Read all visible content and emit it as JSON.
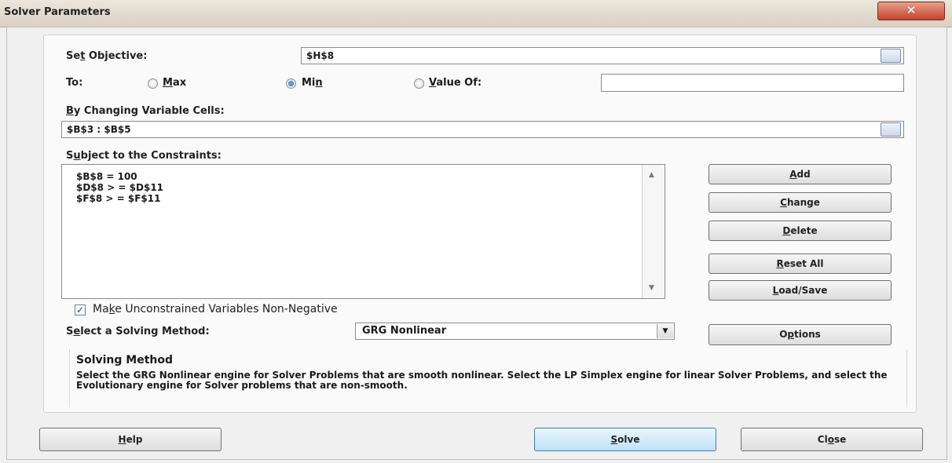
{
  "window": {
    "title": "Solver Parameters",
    "close_glyph": "✕"
  },
  "objective": {
    "label_pre": "Se",
    "label_key": "t",
    "label_post": " Objective:",
    "value": "$H$8"
  },
  "to": {
    "label": "To:",
    "max": {
      "key": "M",
      "rest": "ax",
      "selected": false
    },
    "min": {
      "pre": "Mi",
      "key": "n",
      "selected": true
    },
    "value_of": {
      "key": "V",
      "rest": "alue Of:",
      "value": "",
      "selected": false
    }
  },
  "changing": {
    "label_key": "B",
    "label_rest": "y Changing Variable Cells:",
    "value": "$B$3 : $B$5"
  },
  "constraints": {
    "label_pre": "S",
    "label_key": "u",
    "label_post": "bject to the Constraints:",
    "items": [
      "$B$8 = 100",
      "$D$8 > = $D$11",
      "$F$8 > = $F$11"
    ]
  },
  "buttons": {
    "add": {
      "key": "A",
      "rest": "dd"
    },
    "change": {
      "key": "C",
      "rest": "hange"
    },
    "delete": {
      "key": "D",
      "rest": "elete"
    },
    "reset_all": {
      "key": "R",
      "rest": "eset All"
    },
    "load_save": {
      "key": "L",
      "rest": "oad/Save"
    },
    "options": {
      "pre": "O",
      "key": "p",
      "rest": "tions"
    },
    "help": {
      "key": "H",
      "rest": "elp"
    },
    "solve": {
      "key": "S",
      "rest": "olve"
    },
    "close": {
      "pre": "Cl",
      "key": "o",
      "rest": "se"
    }
  },
  "nonneg": {
    "checked": true,
    "check_glyph": "✓",
    "label_pre": "Ma",
    "label_key": "k",
    "label_post": "e Unconstrained Variables Non-Negative"
  },
  "method": {
    "label_pre": "S",
    "label_key": "e",
    "label_post": "lect a Solving Method:",
    "value": "GRG Nonlinear",
    "arrow_glyph": "▼"
  },
  "solving_method": {
    "title": "Solving Method",
    "description": "Select the GRG Nonlinear engine for Solver Problems that are smooth nonlinear. Select the LP Simplex engine for linear Solver Problems, and select the Evolutionary engine for Solver problems that are non-smooth."
  },
  "icons": {
    "ref": "range-selector-icon",
    "scroll_up": "▲",
    "scroll_down": "▼"
  }
}
